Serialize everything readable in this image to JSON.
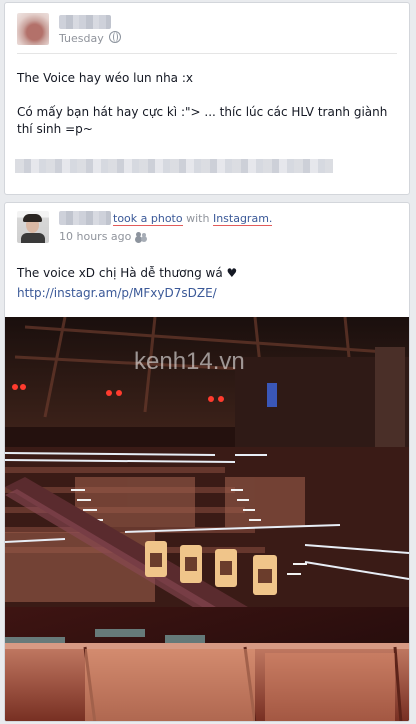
{
  "post1": {
    "timestamp": "Tuesday",
    "line1": "The Voice hay wéo lun nha :x",
    "line2": "Có mấy bạn hát hay cực kì :\"> ... thíc lúc các HLV tranh giành thí sinh =p~"
  },
  "post2": {
    "action": "took a photo",
    "with_word": "with",
    "app": "Instagram.",
    "timestamp": "10 hours ago",
    "caption": "The voice xD chị Hà dễ thương wá ♥",
    "link": "http://instagr.am/p/MFxyD7sDZE/",
    "photo": {
      "watermark": "kenh14.vn",
      "icon": "the-voice-stage-photo"
    }
  },
  "colors": {
    "link_blue": "#3b5998",
    "meta_gray": "#90949c",
    "page_bg": "#e9ebee"
  }
}
